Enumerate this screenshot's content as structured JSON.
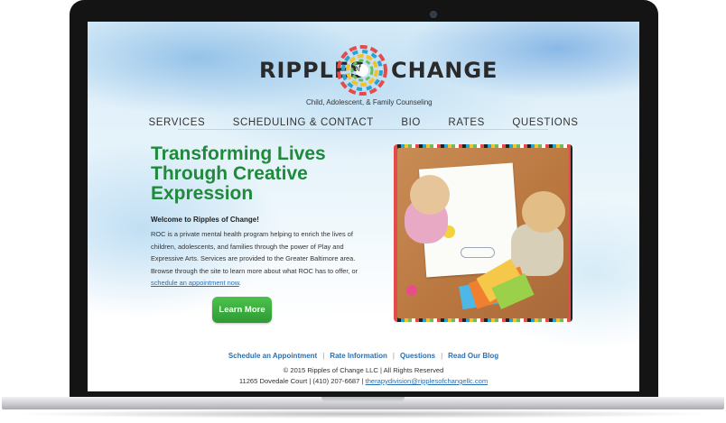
{
  "site": {
    "logo": {
      "word1": "RIPPLES",
      "word_of": "of",
      "word2": "CHANGE",
      "tagline": "Child, Adolescent, & Family Counseling"
    },
    "nav": [
      "SERVICES",
      "SCHEDULING & CONTACT",
      "BIO",
      "RATES",
      "QUESTIONS"
    ],
    "hero": {
      "headline": "Transforming Lives Through Creative Expression",
      "welcome": "Welcome to Ripples of Change!",
      "intro": "ROC is a private mental health program helping to enrich the lives of children, adolescents, and families through the power of Play and Expressive Arts. Services are provided to the Greater Baltimore area. Browse through the site to learn more about what ROC has to offer, or",
      "intro_link": "schedule an appointment now",
      "intro_end": ".",
      "button": "Learn More"
    },
    "footer": {
      "links": [
        "Schedule an Appointment",
        "Rate Information",
        "Questions",
        "Read Our Blog"
      ],
      "copyright": "© 2015 Ripples of Change LLC  |  All Rights Reserved",
      "address": "11265 Dovedale Court  |  (410) 207-6687  |",
      "email": "therapydivision@ripplesofchangellc.com"
    }
  },
  "colors": {
    "headline": "#1f8a3c",
    "button": "#2d9a33",
    "link": "#2a6fb0",
    "bezel": "#141414"
  },
  "icons": {
    "camera": "webcam-dot",
    "logo_mark": "colorful-ripple-circle"
  }
}
